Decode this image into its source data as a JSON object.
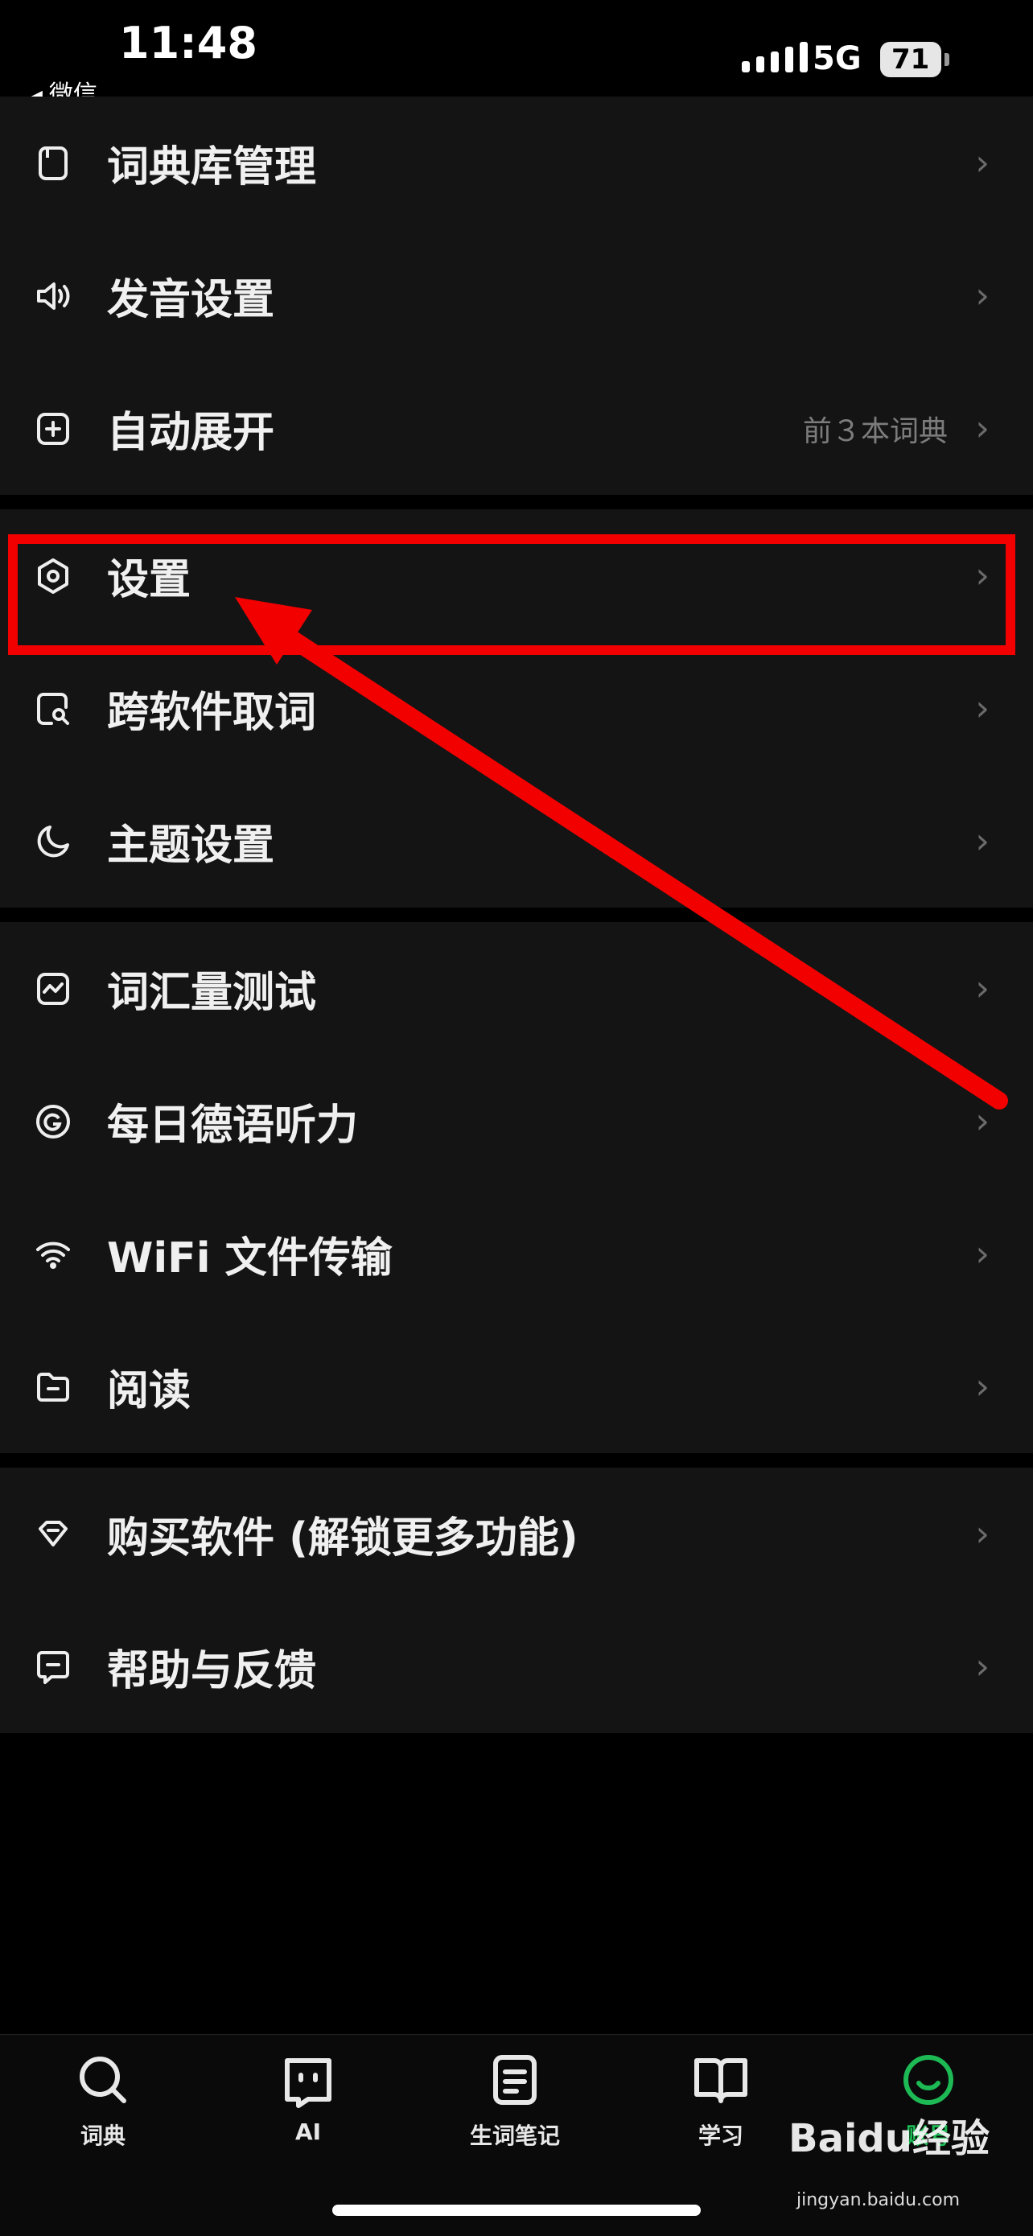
{
  "status": {
    "time": "11:48",
    "back_app": "微信",
    "network": "5G",
    "battery": "71"
  },
  "groups": [
    {
      "items": [
        {
          "icon": "book-icon",
          "label": "词典库管理",
          "value": ""
        },
        {
          "icon": "speaker-icon",
          "label": "发音设置",
          "value": ""
        },
        {
          "icon": "plus-square-icon",
          "label": "自动展开",
          "value": "前３本词典"
        }
      ]
    },
    {
      "items": [
        {
          "icon": "hexagon-settings-icon",
          "label": "设置",
          "value": ""
        },
        {
          "icon": "search-square-icon",
          "label": "跨软件取词",
          "value": ""
        },
        {
          "icon": "moon-icon",
          "label": "主题设置",
          "value": ""
        }
      ]
    },
    {
      "items": [
        {
          "icon": "chart-square-icon",
          "label": "词汇量测试",
          "value": ""
        },
        {
          "icon": "target-icon",
          "label": "每日德语听力",
          "value": ""
        },
        {
          "icon": "wifi-icon",
          "label": "WiFi 文件传输",
          "value": ""
        },
        {
          "icon": "folder-icon",
          "label": "阅读",
          "value": ""
        }
      ]
    },
    {
      "items": [
        {
          "icon": "diamond-icon",
          "label": "购买软件 (解锁更多功能)",
          "value": ""
        },
        {
          "icon": "message-icon",
          "label": "帮助与反馈",
          "value": ""
        }
      ]
    }
  ],
  "tabs": [
    {
      "icon": "search-icon",
      "label": "词典",
      "active": false
    },
    {
      "icon": "ai-icon",
      "label": "AI",
      "active": false
    },
    {
      "icon": "note-icon",
      "label": "生词笔记",
      "active": false
    },
    {
      "icon": "open-book-icon",
      "label": "学习",
      "active": false
    },
    {
      "icon": "smile-icon",
      "label": "账号",
      "active": true
    }
  ],
  "watermark": {
    "brand": "Baidu经验",
    "url": "jingyan.baidu.com"
  },
  "colors": {
    "accent": "#1db954",
    "annotation": "#f20000",
    "row_bg": "#141414"
  }
}
